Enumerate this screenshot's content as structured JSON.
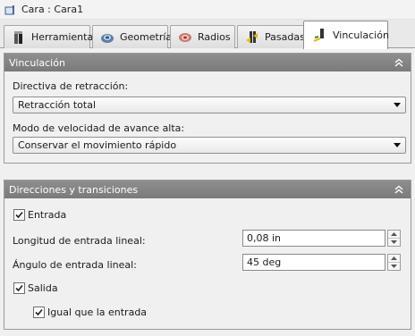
{
  "window": {
    "title": "Cara : Cara1"
  },
  "tabs": [
    {
      "label": "Herramienta",
      "icon": "tool-icon"
    },
    {
      "label": "Geometría",
      "icon": "geometry-icon"
    },
    {
      "label": "Radios",
      "icon": "radii-icon"
    },
    {
      "label": "Pasadas",
      "icon": "passes-icon"
    },
    {
      "label": "Vinculación",
      "icon": "linking-icon",
      "active": true
    }
  ],
  "linking_panel": {
    "header": "Vinculación",
    "retract_label": "Directiva de retracción:",
    "retract_value": "Retracción total",
    "feed_mode_label": "Modo de velocidad de avance alta:",
    "feed_mode_value": "Conservar el movimiento rápido"
  },
  "transitions_panel": {
    "header": "Direcciones y transiciones",
    "entry_label": "Entrada",
    "entry_checked": true,
    "entry_length_label": "Longitud de entrada lineal:",
    "entry_length_value": "0,08 in",
    "entry_angle_label": "Ángulo de entrada lineal:",
    "entry_angle_value": "45 deg",
    "exit_label": "Salida",
    "exit_checked": true,
    "same_as_entry_label": "Igual que la entrada",
    "same_as_entry_checked": true
  },
  "colors": {
    "panel_header": "#858585",
    "active_tab": "#ffffff"
  }
}
